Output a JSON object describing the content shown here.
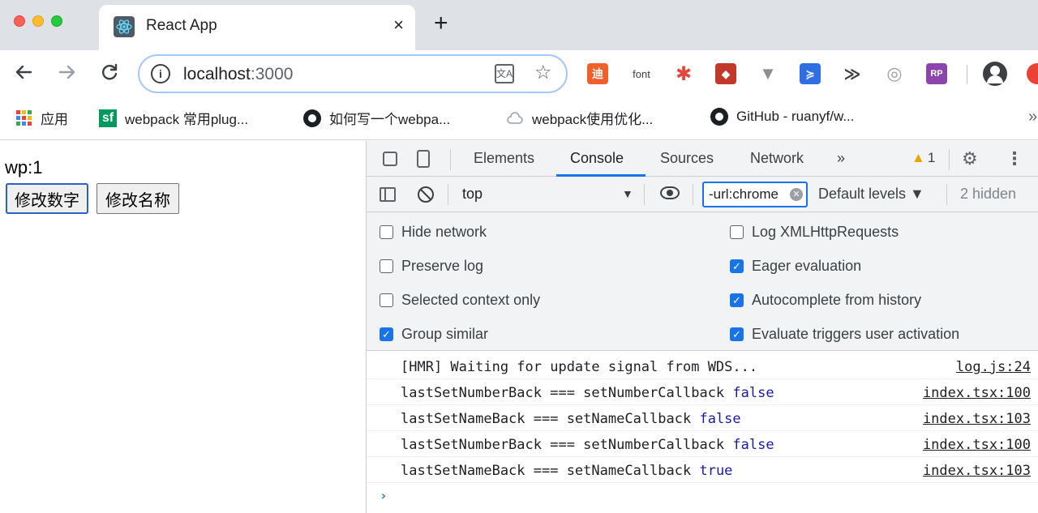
{
  "browser": {
    "tab_title": "React App",
    "tab_close": "×",
    "new_tab": "+",
    "url_host": "localhost",
    "url_port": ":3000",
    "omnibox_info": "i",
    "translate_icon": "文A",
    "extension_font_label": "font",
    "bookmarks": [
      {
        "label": "应用",
        "icon": "apps-grid-icon"
      },
      {
        "label": "webpack 常用plug...",
        "icon": "segmentfault-icon"
      },
      {
        "label": "如何写一个webpa...",
        "icon": "github-icon"
      },
      {
        "label": "webpack使用优化...",
        "icon": "cloud-icon"
      },
      {
        "label": "GitHub - ruanyf/w...",
        "icon": "github-icon"
      }
    ],
    "bookmarks_more": "»"
  },
  "page": {
    "counter_text": "wp:1",
    "btn_change_number": "修改数字",
    "btn_change_name": "修改名称"
  },
  "devtools": {
    "tabs": [
      "Elements",
      "Console",
      "Sources",
      "Network"
    ],
    "active_tab": "Console",
    "more_tabs": "»",
    "warning_count": "1",
    "context": "top",
    "filter_value": "-url:chrome",
    "levels": "Default levels ▼",
    "hidden": "2 hidden",
    "settings": {
      "hide_network": {
        "label": "Hide network",
        "checked": false
      },
      "preserve_log": {
        "label": "Preserve log",
        "checked": false
      },
      "selected_context_only": {
        "label": "Selected context only",
        "checked": false
      },
      "group_similar": {
        "label": "Group similar",
        "checked": true
      },
      "log_xhr": {
        "label": "Log XMLHttpRequests",
        "checked": false
      },
      "eager_evaluation": {
        "label": "Eager evaluation",
        "checked": true
      },
      "autocomplete_history": {
        "label": "Autocomplete from history",
        "checked": true
      },
      "evaluate_triggers": {
        "label": "Evaluate triggers user activation",
        "checked": true
      }
    },
    "logs": [
      {
        "text": "[HMR] Waiting for update signal from WDS...",
        "value": "",
        "source": "log.js:24"
      },
      {
        "text": "lastSetNumberBack === setNumberCallback ",
        "value": "false",
        "source": "index.tsx:100"
      },
      {
        "text": "lastSetNameBack === setNameCallback ",
        "value": "false",
        "source": "index.tsx:103"
      },
      {
        "text": "lastSetNumberBack === setNumberCallback ",
        "value": "false",
        "source": "index.tsx:100"
      },
      {
        "text": "lastSetNameBack === setNameCallback ",
        "value": "true",
        "source": "index.tsx:103"
      }
    ],
    "prompt": "›"
  },
  "colors": {
    "accent": "#1a73e8",
    "warning": "#e8a600",
    "boolean": "#1a1aa6"
  }
}
